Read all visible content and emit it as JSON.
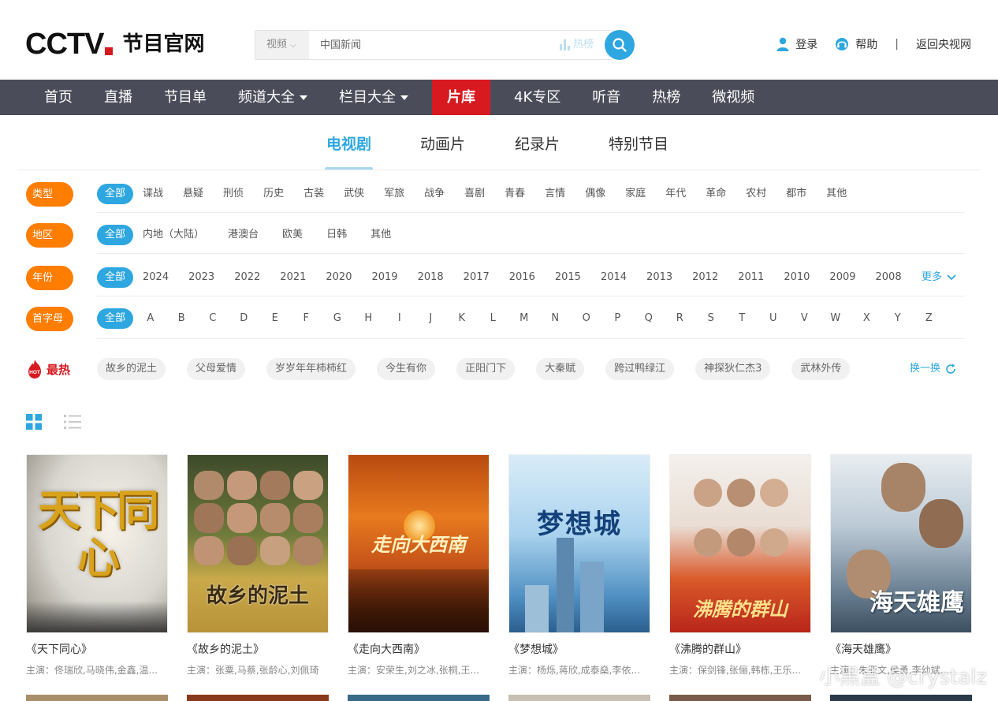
{
  "header": {
    "logo_text": "CCTV",
    "logo_sub": "节目官网",
    "search": {
      "category": "视频",
      "placeholder": "中国新闻",
      "hot_label": "热榜"
    },
    "user_links": {
      "login": "登录",
      "help": "帮助",
      "separator": "|",
      "back": "返回央视网"
    }
  },
  "nav": {
    "items": [
      {
        "label": "首页",
        "dropdown": false
      },
      {
        "label": "直播",
        "dropdown": false
      },
      {
        "label": "节目单",
        "dropdown": false
      },
      {
        "label": "频道大全",
        "dropdown": true
      },
      {
        "label": "栏目大全",
        "dropdown": true
      },
      {
        "label": "片库",
        "dropdown": false,
        "active": true
      },
      {
        "label": "4K专区",
        "dropdown": false
      },
      {
        "label": "听音",
        "dropdown": false
      },
      {
        "label": "热榜",
        "dropdown": false
      },
      {
        "label": "微视频",
        "dropdown": false
      }
    ]
  },
  "category_tabs": [
    "电视剧",
    "动画片",
    "纪录片",
    "特别节目"
  ],
  "filters": {
    "type": {
      "label": "类型",
      "options": [
        "全部",
        "谍战",
        "悬疑",
        "刑侦",
        "历史",
        "古装",
        "武侠",
        "军旅",
        "战争",
        "喜剧",
        "青春",
        "言情",
        "偶像",
        "家庭",
        "年代",
        "革命",
        "农村",
        "都市",
        "其他"
      ]
    },
    "region": {
      "label": "地区",
      "options": [
        "全部",
        "内地（大陆）",
        "港澳台",
        "欧美",
        "日韩",
        "其他"
      ]
    },
    "year": {
      "label": "年份",
      "options": [
        "全部",
        "2024",
        "2023",
        "2022",
        "2021",
        "2020",
        "2019",
        "2018",
        "2017",
        "2016",
        "2015",
        "2014",
        "2013",
        "2012",
        "2011",
        "2010",
        "2009",
        "2008"
      ],
      "more": "更多"
    },
    "letter": {
      "label": "首字母",
      "options": [
        "全部",
        "A",
        "B",
        "C",
        "D",
        "E",
        "F",
        "G",
        "H",
        "I",
        "J",
        "K",
        "L",
        "M",
        "N",
        "O",
        "P",
        "Q",
        "R",
        "S",
        "T",
        "U",
        "V",
        "W",
        "X",
        "Y",
        "Z"
      ]
    }
  },
  "hot": {
    "badge": "HOT",
    "label": "最热",
    "tags": [
      "故乡的泥土",
      "父母爱情",
      "岁岁年年柿柿红",
      "今生有你",
      "正阳门下",
      "大秦赋",
      "跨过鸭绿江",
      "神探狄仁杰3",
      "武林外传"
    ],
    "refresh": "换一换"
  },
  "colors": {
    "accent_blue": "#2ea7e0",
    "nav_bg": "#4a4c59",
    "nav_active": "#d71920",
    "filter_label": "#ff7d00"
  },
  "cards": [
    {
      "title": "《天下同心》",
      "cast": "主演：佟瑞欣,马晓伟,金鑫,温...",
      "art": "天下同心"
    },
    {
      "title": "《故乡的泥土》",
      "cast": "主演：张粟,马蔡,张龄心,刘佩琦",
      "art": "故乡的泥土"
    },
    {
      "title": "《走向大西南》",
      "cast": "主演：安荣生,刘之冰,张桐,王...",
      "art": "走向大西南"
    },
    {
      "title": "《梦想城》",
      "cast": "主演：杨烁,蒋欣,成泰燊,李依...",
      "art": "梦想城"
    },
    {
      "title": "《沸腾的群山》",
      "cast": "主演：保剑锋,张俪,韩栋,王乐...",
      "art": "沸腾的群山"
    },
    {
      "title": "《海天雄鹰》",
      "cast": "主演：朱亚文,侯勇,李幼斌,...",
      "art": "海天雄鹰"
    }
  ],
  "watermark": "小黑盒 @crystalz"
}
